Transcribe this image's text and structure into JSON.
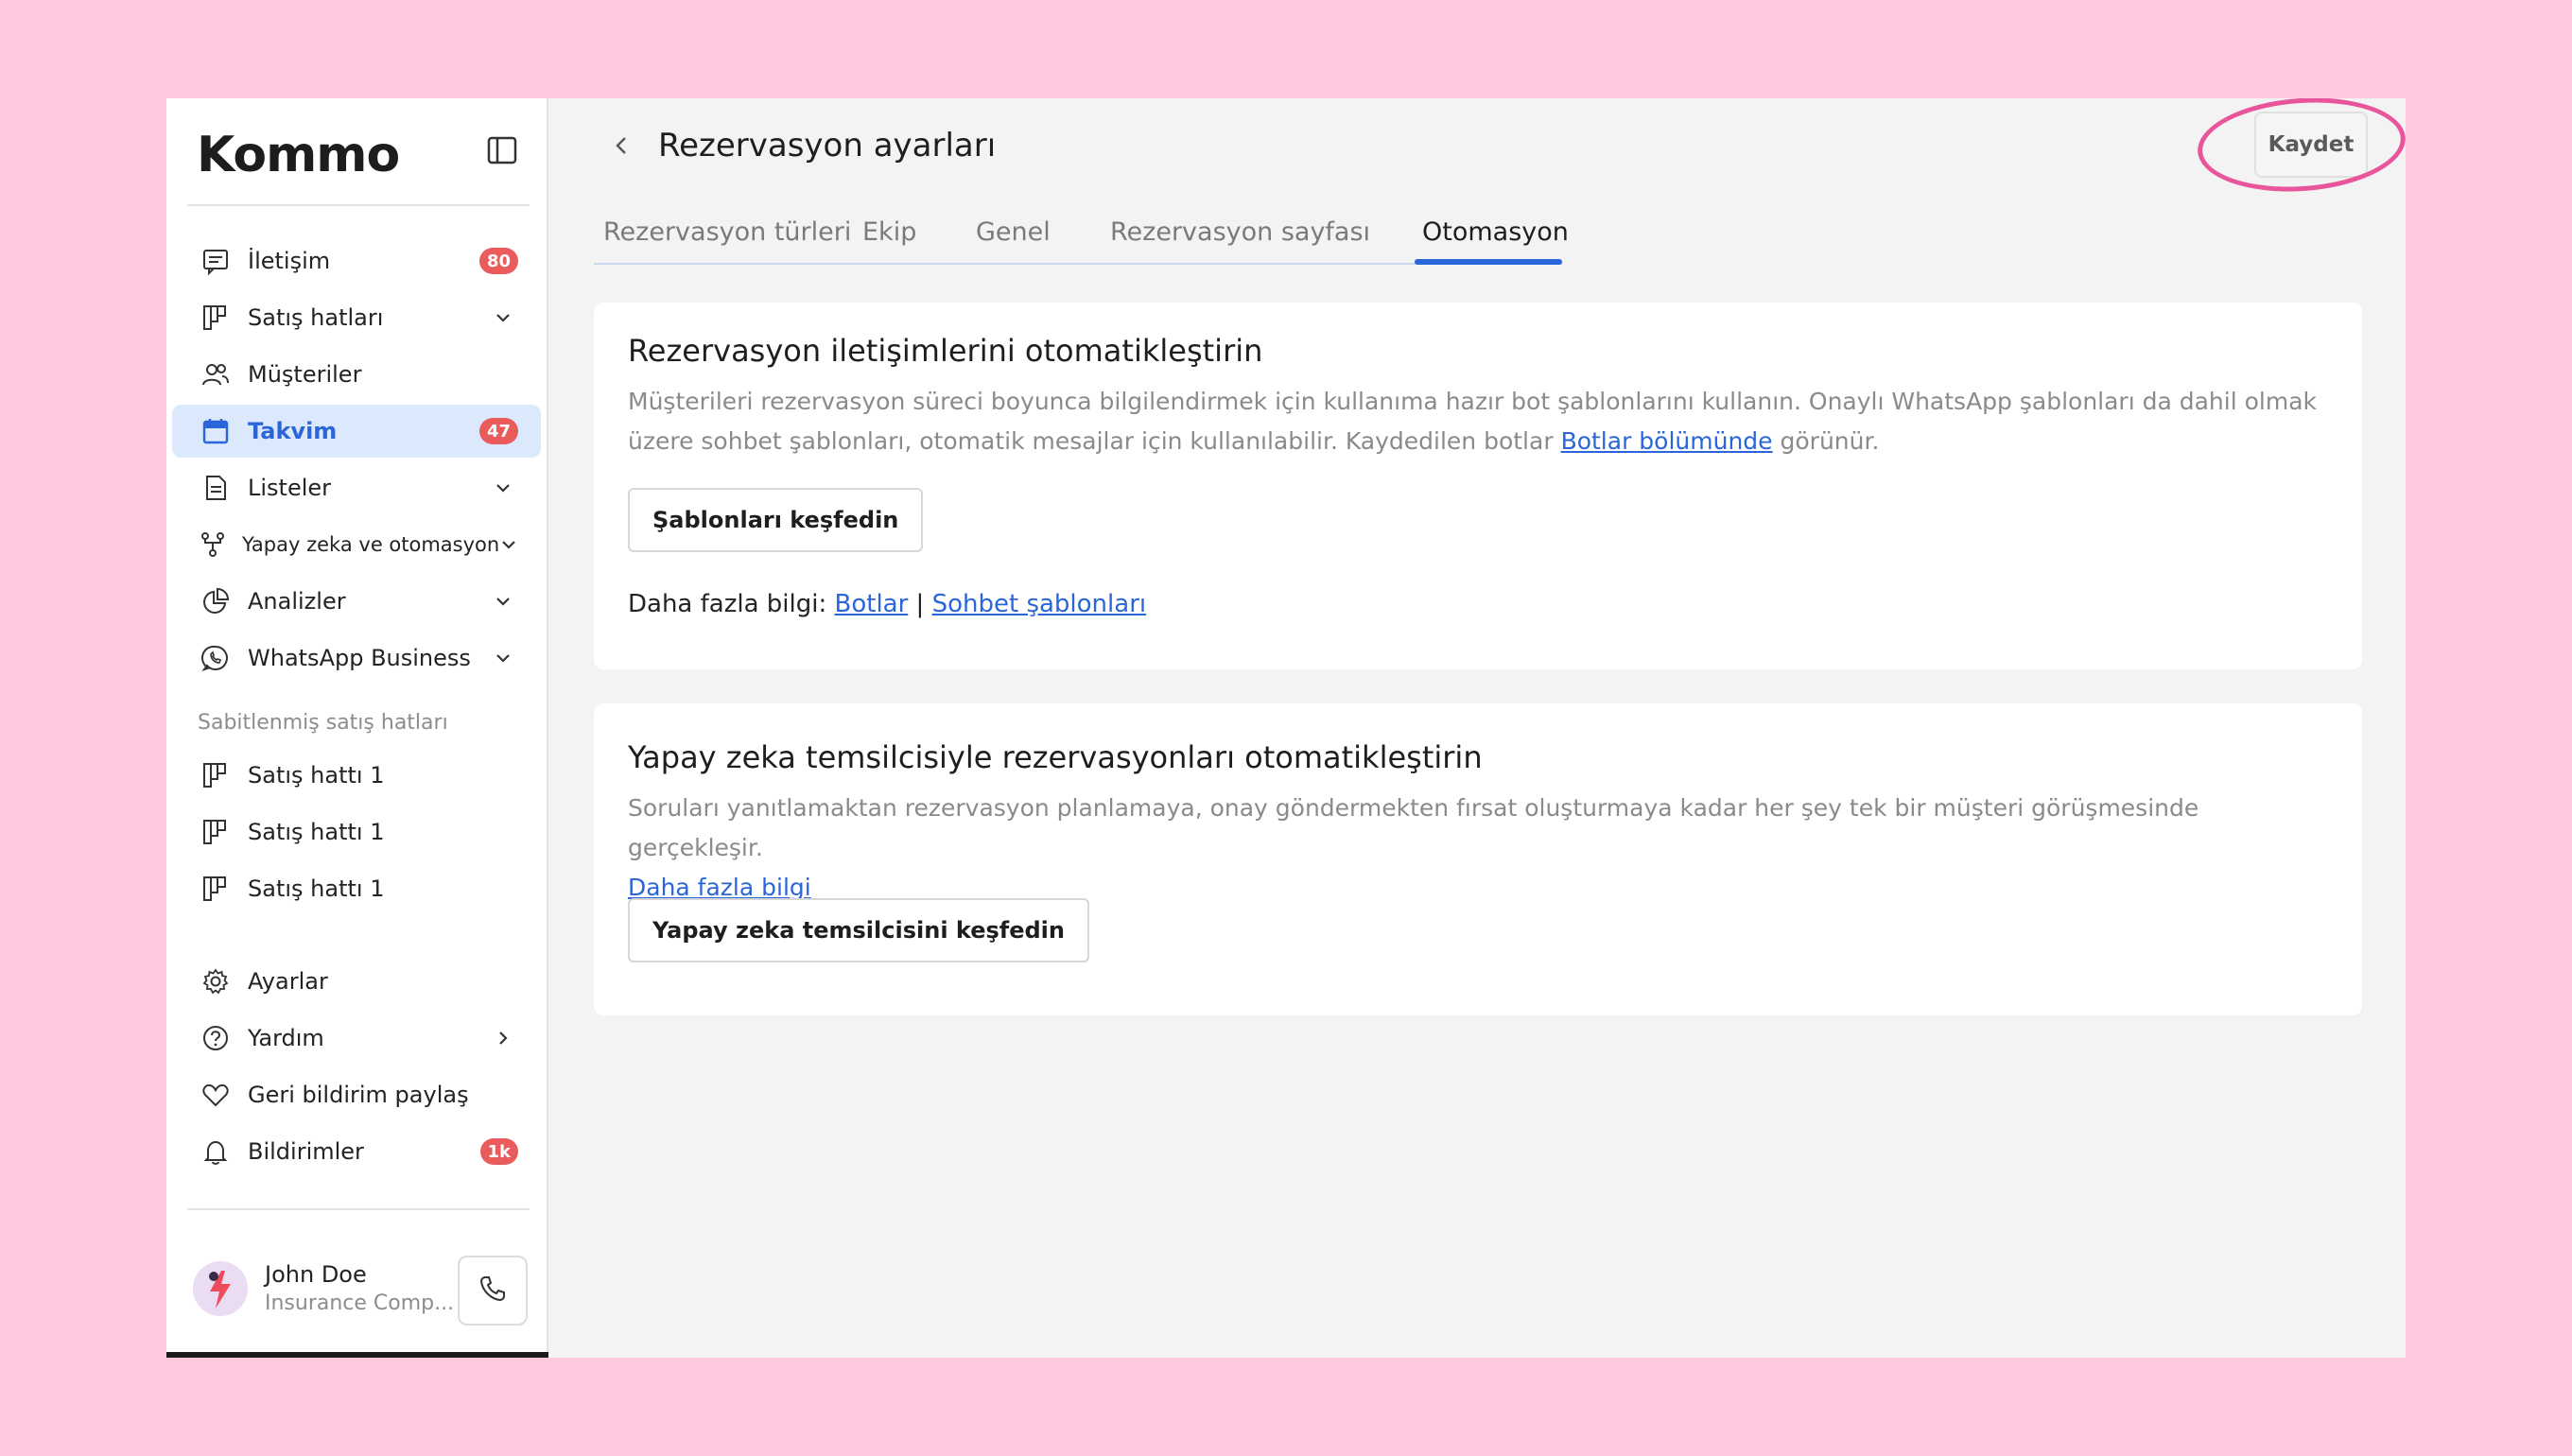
{
  "sidebar": {
    "logo": "Kommo",
    "items": [
      {
        "label": "İletişim",
        "badge": "80"
      },
      {
        "label": "Satış hatları"
      },
      {
        "label": "Müşteriler"
      },
      {
        "label": "Takvim",
        "badge": "47"
      },
      {
        "label": "Listeler"
      },
      {
        "label": "Yapay zeka ve otomasyon"
      },
      {
        "label": "Analizler"
      },
      {
        "label": "WhatsApp Business"
      }
    ],
    "pinned_section_label": "Sabitlenmiş satış hatları",
    "pinned": [
      {
        "label": "Satış hattı 1"
      },
      {
        "label": "Satış hattı 1"
      },
      {
        "label": "Satış hattı 1"
      }
    ],
    "bottom_items": [
      {
        "label": "Ayarlar"
      },
      {
        "label": "Yardım"
      },
      {
        "label": "Geri bildirim paylaş"
      },
      {
        "label": "Bildirimler",
        "badge": "1k"
      }
    ],
    "profile": {
      "name": "John Doe",
      "company": "Insurance Comp..."
    }
  },
  "header": {
    "title": "Rezervasyon ayarları",
    "save_label": "Kaydet"
  },
  "tabs": [
    {
      "label": "Rezervasyon türleri"
    },
    {
      "label": "Ekip"
    },
    {
      "label": "Genel"
    },
    {
      "label": "Rezervasyon sayfası"
    },
    {
      "label": "Otomasyon"
    }
  ],
  "card1": {
    "title": "Rezervasyon iletişimlerini otomatikleştirin",
    "desc_part1": "Müşterileri rezervasyon süreci boyunca bilgilendirmek için kullanıma hazır bot şablonlarını kullanın. Onaylı WhatsApp şablonları da dahil olmak üzere sohbet şablonları, otomatik mesajlar için kullanılabilir. Kaydedilen botlar ",
    "desc_link": "Botlar bölümünde",
    "desc_part2": " görünür.",
    "button": "Şablonları keşfedin",
    "more_label": "Daha fazla bilgi: ",
    "more_link1": "Botlar",
    "more_sep": " | ",
    "more_link2": "Sohbet şablonları"
  },
  "card2": {
    "title": "Yapay zeka temsilcisiyle rezervasyonları otomatikleştirin",
    "desc": "Soruları yanıtlamaktan rezervasyon planlamaya, onay göndermekten fırsat oluşturmaya kadar her şey tek bir müşteri görüşmesinde gerçekleşir.",
    "link": "Daha fazla bilgi",
    "button": "Yapay zeka temsilcisini keşfedin"
  },
  "colors": {
    "accent": "#2a66d9",
    "badge": "#ea5b5b",
    "highlight": "#e8559a",
    "active_bg": "#dce8fb"
  }
}
